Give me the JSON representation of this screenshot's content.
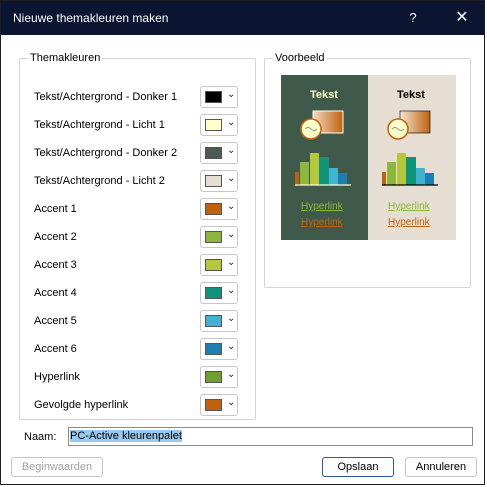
{
  "window": {
    "title": "Nieuwe themakleuren maken",
    "help": "?",
    "close": "✕"
  },
  "themakleuren": {
    "group_label": "Themakleuren",
    "items": [
      {
        "label": "Tekst/Achtergrond - Donker 1",
        "color": "#000000"
      },
      {
        "label": "Tekst/Achtergrond - Licht 1",
        "color": "#FFFFCC"
      },
      {
        "label": "Tekst/Achtergrond - Donker 2",
        "color": "#4B5A53"
      },
      {
        "label": "Tekst/Achtergrond - Licht 2",
        "color": "#E6DDD3"
      },
      {
        "label": "Accent 1",
        "color": "#C0620D"
      },
      {
        "label": "Accent 2",
        "color": "#8DB63C"
      },
      {
        "label": "Accent 3",
        "color": "#B5C83B"
      },
      {
        "label": "Accent 4",
        "color": "#11937A"
      },
      {
        "label": "Accent 5",
        "color": "#41B3CF"
      },
      {
        "label": "Accent 6",
        "color": "#1D7FAF"
      },
      {
        "label": "Hyperlink",
        "color": "#6FA02D"
      },
      {
        "label": "Gevolgde hyperlink",
        "color": "#C0620D"
      }
    ]
  },
  "voorbeeld": {
    "group_label": "Voorbeeld",
    "dark": {
      "title": "Tekst",
      "hyperlink": "Hyperlink",
      "followed": "Hyperlink"
    },
    "light": {
      "title": "Tekst",
      "hyperlink": "Hyperlink",
      "followed": "Hyperlink"
    }
  },
  "name": {
    "label": "Naam:",
    "value": "PC-Active kleurenpalet"
  },
  "buttons": {
    "reset": "Beginwaarden",
    "save": "Opslaan",
    "cancel": "Annuleren"
  }
}
